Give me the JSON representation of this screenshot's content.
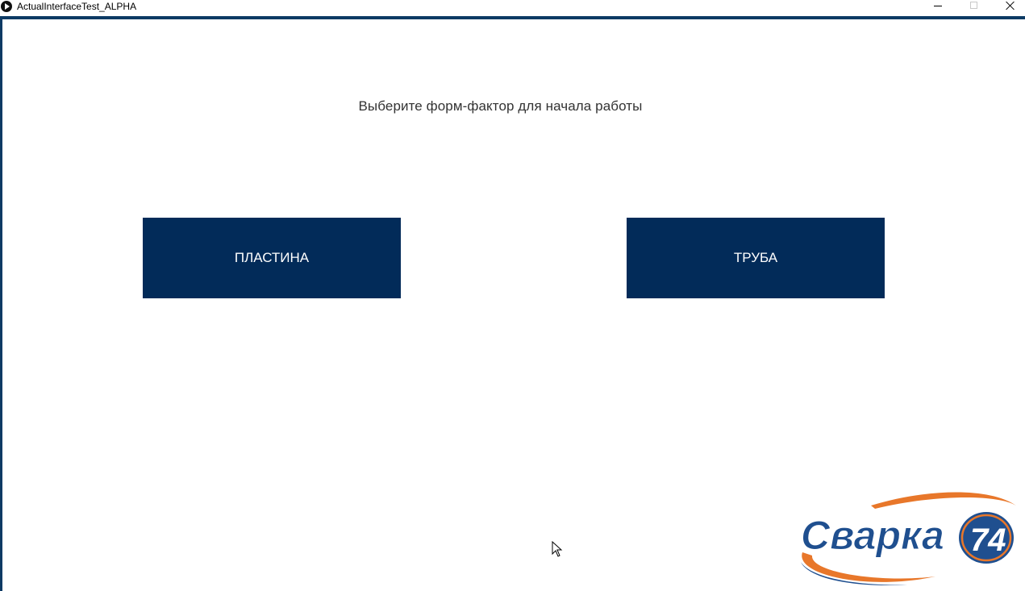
{
  "window": {
    "title": "ActualInterfaceTest_ALPHA"
  },
  "main": {
    "prompt": "Выберите форм-фактор для начала работы",
    "buttons": [
      {
        "label": "ПЛАСТИНА"
      },
      {
        "label": "ТРУБА"
      }
    ]
  },
  "logo": {
    "wordmark": "Сварка",
    "badge": "74"
  },
  "colors": {
    "button_bg": "#022b59",
    "frame": "#0d3a64",
    "logo_blue": "#1f4f8f",
    "logo_orange": "#e8772a"
  },
  "icons": [
    "app-icon",
    "minimize-icon",
    "maximize-icon",
    "close-icon",
    "mouse-cursor-icon"
  ]
}
